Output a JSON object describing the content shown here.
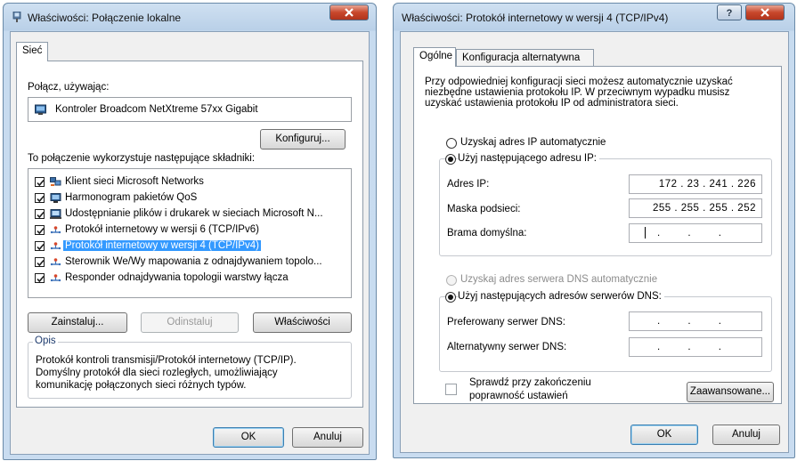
{
  "win1": {
    "title": "Właściwości: Połączenie lokalne",
    "tab": "Sieć",
    "connect_label": "Połącz, używając:",
    "adapter": "Kontroler Broadcom NetXtreme 57xx Gigabit",
    "configure_button": "Konfiguruj...",
    "components_label": "To połączenie wykorzystuje następujące składniki:",
    "components": [
      {
        "label": "Klient sieci Microsoft Networks",
        "checked": true,
        "icon": "network-client-icon"
      },
      {
        "label": "Harmonogram pakietów QoS",
        "checked": true,
        "icon": "qos-icon"
      },
      {
        "label": "Udostępnianie plików i drukarek w sieciach Microsoft N...",
        "checked": true,
        "icon": "file-sharing-icon"
      },
      {
        "label": "Protokół internetowy w wersji 6 (TCP/IPv6)",
        "checked": true,
        "icon": "protocol-icon"
      },
      {
        "label": "Protokół internetowy w wersji 4 (TCP/IPv4)",
        "checked": true,
        "icon": "protocol-icon",
        "selected": true
      },
      {
        "label": "Sterownik We/Wy mapowania z odnajdywaniem topolo...",
        "checked": true,
        "icon": "protocol-icon"
      },
      {
        "label": "Responder odnajdywania topologii warstwy łącza",
        "checked": true,
        "icon": "protocol-icon"
      }
    ],
    "install_button": "Zainstaluj...",
    "uninstall_button": "Odinstaluj",
    "properties_button": "Właściwości",
    "description_title": "Opis",
    "description_lines": [
      "Protokół kontroli transmisji/Protokół internetowy (TCP/IP).",
      "Domyślny protokół dla sieci rozległych, umożliwiający",
      "komunikację połączonych sieci różnych typów."
    ],
    "ok_button": "OK",
    "cancel_button": "Anuluj"
  },
  "win2": {
    "title": "Właściwości: Protokół internetowy w wersji 4 (TCP/IPv4)",
    "tabs": [
      "Ogólne",
      "Konfiguracja alternatywna"
    ],
    "intro_lines": [
      "Przy odpowiedniej konfiguracji sieci możesz automatycznie uzyskać",
      "niezbędne ustawienia protokołu IP. W przeciwnym wypadku musisz",
      "uzyskać ustawienia protokołu IP od administratora sieci."
    ],
    "radio_ip_auto": "Uzyskaj adres IP automatycznie",
    "radio_ip_manual": "Użyj następującego adresu IP:",
    "ip_label": "Adres IP:",
    "ip_value": "172 . 23 . 241 . 226",
    "mask_label": "Maska podsieci:",
    "mask_value": "255 . 255 . 255 . 252",
    "gateway_label": "Brama domyślna:",
    "empty_ip": ". . .",
    "radio_dns_auto": "Uzyskaj adres serwera DNS automatycznie",
    "radio_dns_manual": "Użyj następujących adresów serwerów DNS:",
    "dns_pref_label": "Preferowany serwer DNS:",
    "dns_alt_label": "Alternatywny serwer DNS:",
    "validate_line1": "Sprawdź przy zakończeniu",
    "validate_line2": "poprawność ustawień",
    "advanced_button": "Zaawansowane...",
    "ok_button": "OK",
    "cancel_button": "Anuluj"
  }
}
